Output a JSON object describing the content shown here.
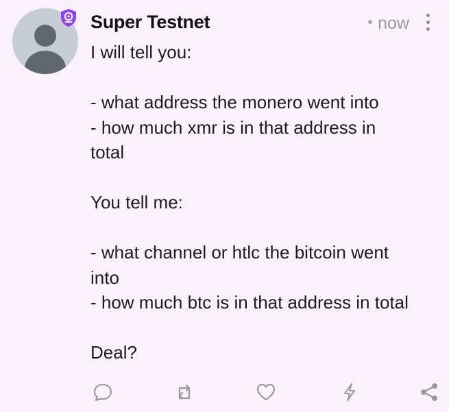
{
  "post": {
    "author": "Super Testnet",
    "timestamp": "now",
    "lines": [
      "I will tell you:",
      "",
      "- what address the monero went into",
      "- how much xmr is in that address in",
      "total",
      "",
      "You tell me:",
      "",
      "- what channel or htlc the bitcoin went",
      "into",
      "- how much btc is in that address in total",
      "",
      "Deal?"
    ]
  },
  "icons": {
    "avatar": "default-user-avatar",
    "badge": "verified-shield-icon",
    "more": "more-vertical-icon",
    "reply": "reply-icon",
    "repost": "repost-icon",
    "like": "heart-icon",
    "zap": "zap-icon",
    "share": "share-icon"
  },
  "colors": {
    "background": "#fbf1fc",
    "accent": "#8e44e6",
    "icon": "#9a9a9a"
  }
}
